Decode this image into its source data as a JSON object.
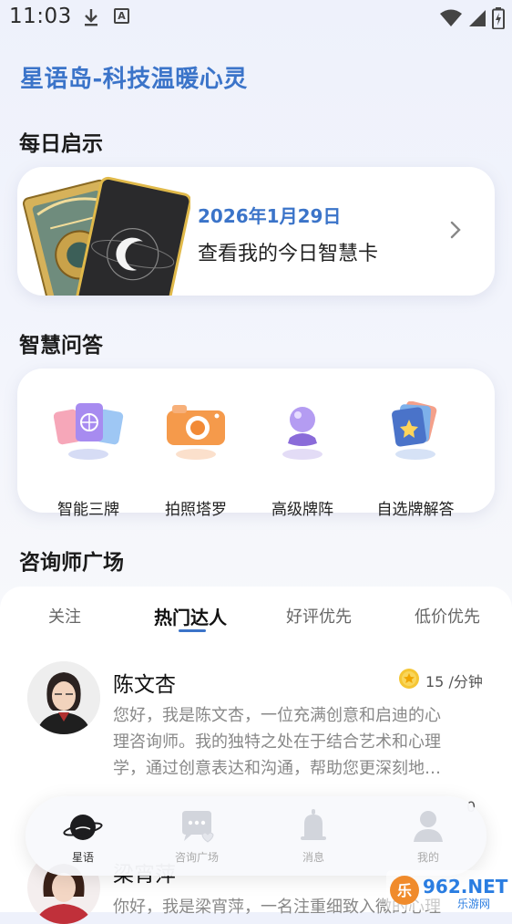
{
  "status_bar": {
    "time": "11:03"
  },
  "brand": {
    "title": "星语岛-科技温暖心灵"
  },
  "daily": {
    "section_title": "每日启示",
    "date": "2026年1月29日",
    "text": "查看我的今日智慧卡"
  },
  "qa": {
    "section_title": "智慧问答",
    "items": [
      {
        "label": "智能三牌",
        "icon": "three-cards-icon"
      },
      {
        "label": "拍照塔罗",
        "icon": "camera-icon"
      },
      {
        "label": "高级牌阵",
        "icon": "crystal-ball-icon"
      },
      {
        "label": "自选牌解答",
        "icon": "card-stack-icon"
      }
    ]
  },
  "consult": {
    "section_title": "咨询师广场",
    "tabs": [
      {
        "label": "关注",
        "active": false
      },
      {
        "label": "热门达人",
        "active": true
      },
      {
        "label": "好评优先",
        "active": false
      },
      {
        "label": "低价优先",
        "active": false
      }
    ],
    "counselors": [
      {
        "name": "陈文杏",
        "price": "15 /分钟",
        "desc_line1": "您好，我是陈文杏，一位充满创意和启迪的心",
        "desc_line2": "理咨询师。我的独特之处在于结合艺术和心理",
        "desc_line3": "学，通过创意表达和沟通，帮助您更深刻地…"
      },
      {
        "name": "梁宵萍",
        "price_partial": "0",
        "desc_line1": "你好，我是梁宵萍，一名注重细致入微的心理"
      }
    ]
  },
  "bottom_nav": {
    "items": [
      {
        "label": "星语",
        "icon": "planet-icon",
        "active": true
      },
      {
        "label": "咨询广场",
        "icon": "chat-bubble-icon",
        "active": false
      },
      {
        "label": "消息",
        "icon": "bell-icon",
        "active": false
      },
      {
        "label": "我的",
        "icon": "user-icon",
        "active": false
      }
    ]
  },
  "watermark": {
    "text": "962.NET",
    "sub": "乐游网"
  },
  "colors": {
    "accent": "#3b74c9",
    "text": "#111111",
    "muted": "#888888"
  }
}
